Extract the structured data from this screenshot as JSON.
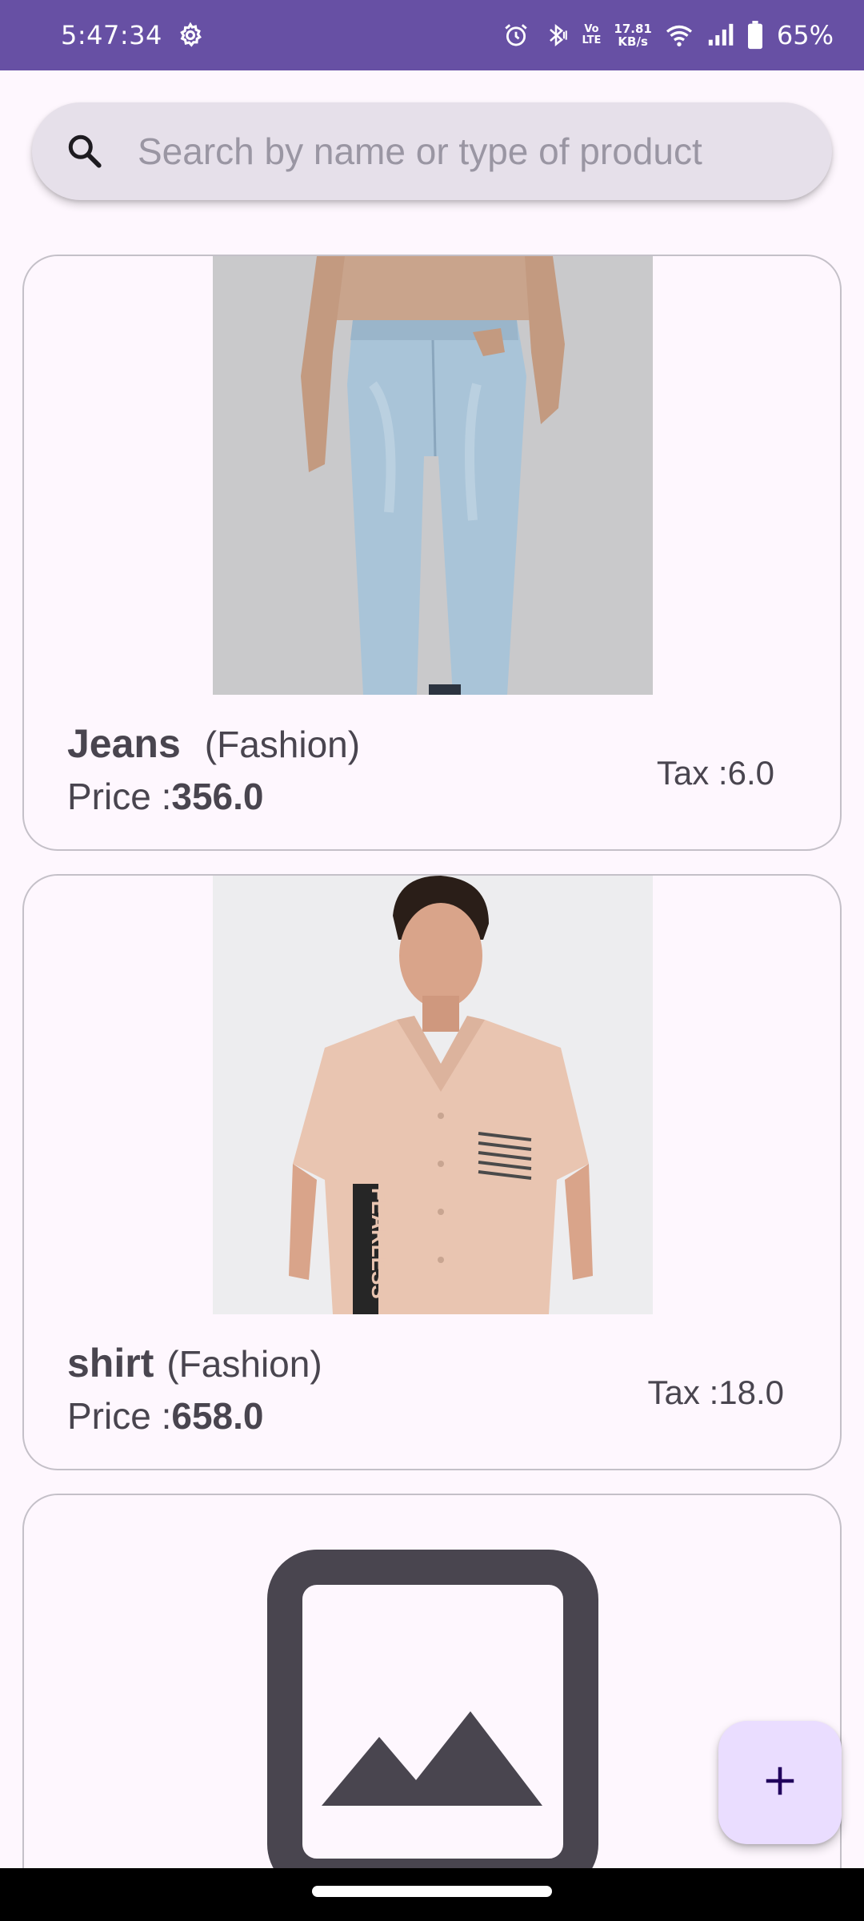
{
  "status_bar": {
    "time": "5:47:34",
    "net_speed_value": "17.81",
    "net_speed_unit": "KB/s",
    "volte_top": "Vo",
    "volte_bottom": "LTE",
    "battery_percent": "65%",
    "icons": [
      "settings-gear-icon",
      "alarm-icon",
      "bluetooth-icon",
      "wifi-icon",
      "cellular-signal-icon",
      "battery-icon"
    ]
  },
  "search": {
    "placeholder": "Search by name or type of product",
    "value": ""
  },
  "products": [
    {
      "name": "Jeans",
      "category": "(Fashion)",
      "price_label": "Price :",
      "price": "356.0",
      "tax": "Tax :6.0",
      "image": "jeans-photo"
    },
    {
      "name": "shirt",
      "category": "(Fashion)",
      "price_label": "Price :",
      "price": "658.0",
      "tax": "Tax :18.0",
      "image": "shirt-photo",
      "shirt_print_text": "FEARLESS"
    },
    {
      "image": "image-placeholder-icon"
    }
  ],
  "fab": {
    "icon": "plus-icon"
  },
  "colors": {
    "status_bar": "#6750a4",
    "background": "#fef7fe",
    "search_bar": "#e6e0ea",
    "fab": "#eaddff",
    "text": "#49454f"
  }
}
